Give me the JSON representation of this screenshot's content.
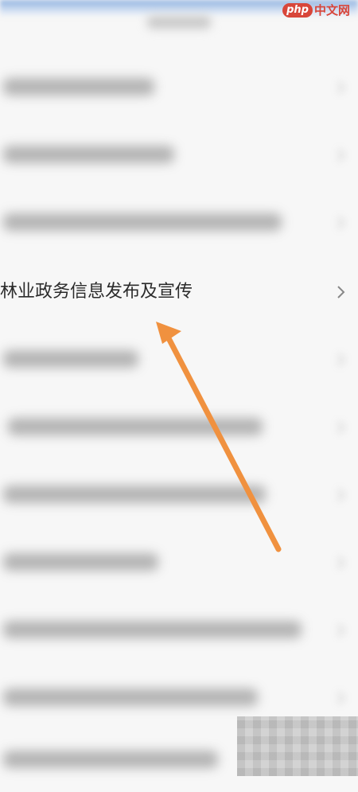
{
  "watermark": {
    "php": "php",
    "site": "中文网"
  },
  "list": {
    "items": [
      {
        "label": "",
        "blurred": true
      },
      {
        "label": "",
        "blurred": true
      },
      {
        "label": "",
        "blurred": true
      },
      {
        "label": "林业政务信息发布及宣传",
        "blurred": false
      },
      {
        "label": "",
        "blurred": true
      },
      {
        "label": "",
        "blurred": true
      },
      {
        "label": "",
        "blurred": true
      },
      {
        "label": "",
        "blurred": true
      },
      {
        "label": "",
        "blurred": true
      },
      {
        "label": "",
        "blurred": true
      },
      {
        "label": "",
        "blurred": true
      }
    ]
  },
  "colors": {
    "arrow": "#f0913f",
    "watermark": "#d8463a"
  },
  "icons": {
    "row_chevron": "chevron-right-icon"
  }
}
